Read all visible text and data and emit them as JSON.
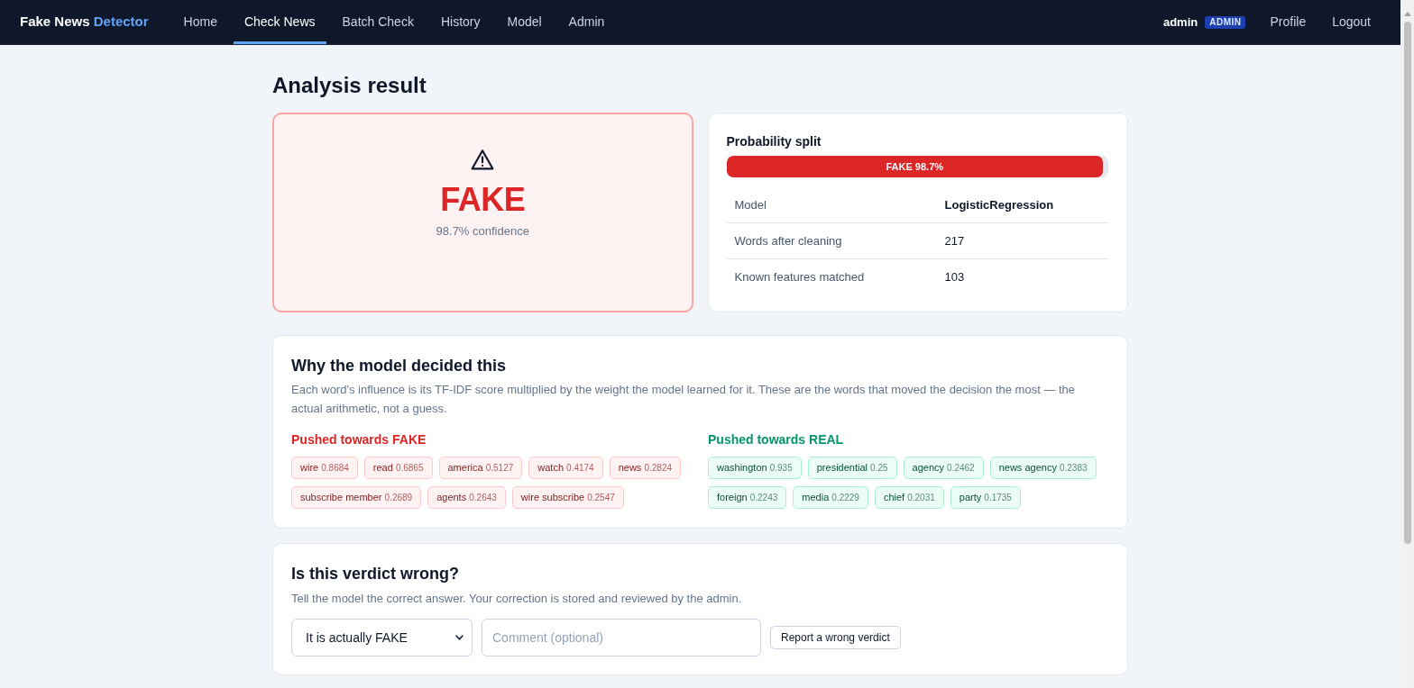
{
  "nav": {
    "brand": {
      "name": "Fake News",
      "accent": "Detector"
    },
    "links": [
      {
        "label": "Home",
        "selected": false
      },
      {
        "label": "Check News",
        "selected": true
      },
      {
        "label": "Batch Check",
        "selected": false
      },
      {
        "label": "History",
        "selected": false
      },
      {
        "label": "Model",
        "selected": false
      },
      {
        "label": "Admin",
        "selected": false
      }
    ],
    "user": {
      "name": "admin",
      "badge": "ADMIN"
    },
    "actions": [
      "Profile",
      "Logout"
    ]
  },
  "page_title": "Analysis result",
  "verdict": {
    "fake": true,
    "label": "FAKE",
    "confidence": "98.7% confidence"
  },
  "probability": {
    "title": "Probability split",
    "bar_label": "FAKE 98.7%",
    "level": 0.987
  },
  "details": [
    {
      "label": "Model",
      "value": "LogisticRegression",
      "emphasized": true
    },
    {
      "label": "Words after cleaning",
      "value": "217",
      "emphasized": false
    },
    {
      "label": "Known features matched",
      "value": "103",
      "emphasized": false
    }
  ],
  "explanation": {
    "title": "Why the model decided this",
    "description": "Each word's influence is its TF-IDF score multiplied by the weight the model learned for it. These are the words that moved the decision the most — the actual arithmetic, not a guess.",
    "groups": [
      {
        "kind": "fake",
        "title": "Pushed towards FAKE",
        "words": [
          {
            "word": "wire",
            "score": "0.8684"
          },
          {
            "word": "read",
            "score": "0.6865"
          },
          {
            "word": "america",
            "score": "0.5127"
          },
          {
            "word": "watch",
            "score": "0.4174"
          },
          {
            "word": "news",
            "score": "0.2824"
          },
          {
            "word": "subscribe member",
            "score": "0.2689"
          },
          {
            "word": "agents",
            "score": "0.2643"
          },
          {
            "word": "wire subscribe",
            "score": "0.2547"
          }
        ]
      },
      {
        "kind": "real",
        "title": "Pushed towards REAL",
        "words": [
          {
            "word": "washington",
            "score": "0.935"
          },
          {
            "word": "presidential",
            "score": "0.25"
          },
          {
            "word": "agency",
            "score": "0.2462"
          },
          {
            "word": "news agency",
            "score": "0.2383"
          },
          {
            "word": "foreign",
            "score": "0.2243"
          },
          {
            "word": "media",
            "score": "0.2229"
          },
          {
            "word": "chief",
            "score": "0.2031"
          },
          {
            "word": "party",
            "score": "0.1735"
          }
        ]
      }
    ]
  },
  "feedback": {
    "title": "Is this verdict wrong?",
    "description": "Tell the model the correct answer. Your correction is stored and reviewed by the admin.",
    "choice": {
      "value": "It is actually FAKE"
    },
    "comment": {
      "placeholder": "Comment (optional)"
    },
    "button": "Report a wrong verdict"
  }
}
